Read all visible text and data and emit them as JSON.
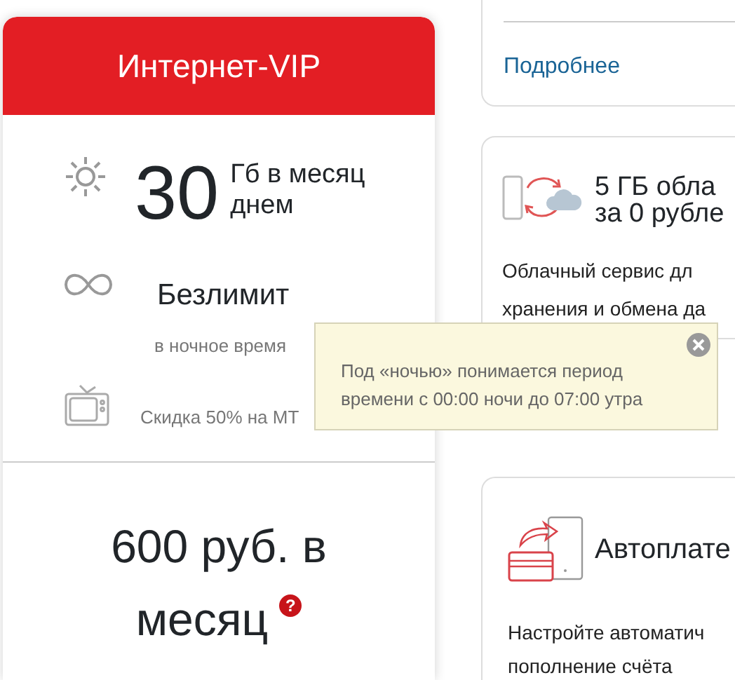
{
  "plan_card": {
    "title": "Интернет-VIP",
    "features": [
      {
        "kind": "day",
        "amount": "30",
        "unit_lines": [
          "Гб в месяц",
          "днем"
        ]
      },
      {
        "kind": "night",
        "label": "Безлимит",
        "note": "в ночное время"
      },
      {
        "kind": "tv",
        "note": "Скидка 50% на МТ"
      }
    ],
    "price_lines": [
      "600 руб. в",
      "месяц"
    ],
    "help_mark": "?"
  },
  "side_cards": [
    {
      "kind": "link_only",
      "link": "Подробнее"
    },
    {
      "kind": "cloud",
      "title_lines": [
        "5 ГБ обла",
        "за 0 рубле"
      ],
      "text_lines": [
        "Облачный сервис дл",
        "хранения и обмена да"
      ]
    },
    {
      "kind": "autopay",
      "title_lines": [
        "Автоплате"
      ],
      "text_lines": [
        "Настройте автоматич",
        "пополнение счёта"
      ]
    }
  ],
  "tooltip": {
    "lines": [
      "Под «ночью» понимается период",
      "времени с 00:00 ночи до 07:00 утра"
    ]
  }
}
